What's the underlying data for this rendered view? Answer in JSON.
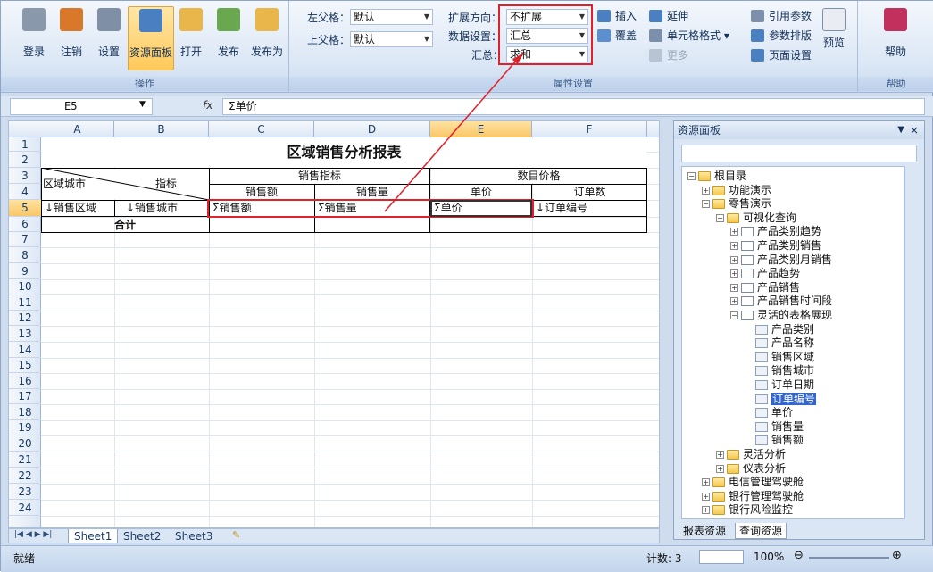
{
  "ribbon": {
    "buttons": [
      {
        "label": "登录",
        "icon": "login-icon",
        "color": "#8a98ac"
      },
      {
        "label": "注销",
        "icon": "logout-icon",
        "color": "#d9772b"
      },
      {
        "label": "设置",
        "icon": "settings-icon",
        "color": "#7f8fa6"
      },
      {
        "label": "资源面板",
        "icon": "resource-panel-icon",
        "color": "#4a7fc1"
      },
      {
        "label": "打开",
        "icon": "open-folder-icon",
        "color": "#e8b64a"
      },
      {
        "label": "发布",
        "icon": "publish-icon",
        "color": "#6aa84f"
      },
      {
        "label": "发布为",
        "icon": "publish-as-icon",
        "color": "#e8b64a"
      }
    ],
    "group_operation": "操作",
    "group_properties": "属性设置",
    "group_help": "帮助",
    "left_parent_label": "左父格：",
    "left_parent_value": "默认",
    "top_parent_label": "上父格：",
    "top_parent_value": "默认",
    "expand_dir_label": "扩展方向：",
    "expand_dir_value": "不扩展",
    "data_setting_label": "数据设置：",
    "data_setting_value": "汇总",
    "summary_label": "汇总：",
    "summary_value": "求和",
    "insert": "插入",
    "cover": "覆盖",
    "extend": "延伸",
    "cell_format": "单元格格式",
    "more": "更多",
    "ref_params": "引用参数",
    "param_layout": "参数排版",
    "page_setup": "页面设置",
    "preview": "预览",
    "help": "帮助"
  },
  "formula_bar": {
    "name_box": "E5",
    "fx": "fx",
    "formula": "Σ单价"
  },
  "sheet": {
    "columns": [
      "A",
      "B",
      "C",
      "D",
      "E",
      "F"
    ],
    "rows": [
      "1",
      "2",
      "3",
      "4",
      "5",
      "6",
      "7",
      "8",
      "9",
      "10",
      "11",
      "12",
      "13",
      "14",
      "15",
      "16",
      "17",
      "18",
      "19",
      "20",
      "21",
      "22",
      "23",
      "24"
    ],
    "title": "区域销售分析报表",
    "h_region_city": "区域城市",
    "h_indicator": "指标",
    "h_sales_metric": "销售指标",
    "h_price": "数目价格",
    "h_amount": "销售额",
    "h_qty": "销售量",
    "h_unit_price": "单价",
    "h_order_count": "订单数",
    "r5_a": "↓销售区域",
    "r5_b": "↓销售城市",
    "r5_c": "Σ销售额",
    "r5_d": "Σ销售量",
    "r5_e": "Σ单价",
    "r5_f": "↓订单编号",
    "total": "合计",
    "tabs": [
      "Sheet1",
      "Sheet2",
      "Sheet3"
    ]
  },
  "status": {
    "ready": "就绪",
    "count": "计数: 3",
    "zoom": "100%"
  },
  "panel": {
    "title": "资源面板",
    "tree": [
      {
        "label": "根目录",
        "level": 0,
        "type": "folder",
        "exp": "−"
      },
      {
        "label": "功能演示",
        "level": 1,
        "type": "folder",
        "exp": "+"
      },
      {
        "label": "零售演示",
        "level": 1,
        "type": "folder",
        "exp": "−"
      },
      {
        "label": "可视化查询",
        "level": 2,
        "type": "folder",
        "exp": "−"
      },
      {
        "label": "产品类别趋势",
        "level": 3,
        "type": "check",
        "exp": "+"
      },
      {
        "label": "产品类别销售",
        "level": 3,
        "type": "check",
        "exp": "+"
      },
      {
        "label": "产品类别月销售",
        "level": 3,
        "type": "check",
        "exp": "+"
      },
      {
        "label": "产品趋势",
        "level": 3,
        "type": "check",
        "exp": "+"
      },
      {
        "label": "产品销售",
        "level": 3,
        "type": "check",
        "exp": "+"
      },
      {
        "label": "产品销售时间段",
        "level": 3,
        "type": "check",
        "exp": "+"
      },
      {
        "label": "灵活的表格展现",
        "level": 3,
        "type": "check",
        "exp": "−"
      },
      {
        "label": "产品类别",
        "level": 4,
        "type": "doc",
        "exp": ""
      },
      {
        "label": "产品名称",
        "level": 4,
        "type": "doc",
        "exp": ""
      },
      {
        "label": "销售区域",
        "level": 4,
        "type": "doc",
        "exp": ""
      },
      {
        "label": "销售城市",
        "level": 4,
        "type": "doc",
        "exp": ""
      },
      {
        "label": "订单日期",
        "level": 4,
        "type": "doc",
        "exp": ""
      },
      {
        "label": "订单编号",
        "level": 4,
        "type": "doc",
        "exp": "",
        "selected": true
      },
      {
        "label": "单价",
        "level": 4,
        "type": "doc",
        "exp": ""
      },
      {
        "label": "销售量",
        "level": 4,
        "type": "doc",
        "exp": ""
      },
      {
        "label": "销售额",
        "level": 4,
        "type": "doc",
        "exp": ""
      },
      {
        "label": "灵活分析",
        "level": 2,
        "type": "folder",
        "exp": "+"
      },
      {
        "label": "仪表分析",
        "level": 2,
        "type": "folder",
        "exp": "+"
      },
      {
        "label": "电信管理驾驶舱",
        "level": 1,
        "type": "folder",
        "exp": "+"
      },
      {
        "label": "银行管理驾驶舱",
        "level": 1,
        "type": "folder",
        "exp": "+"
      },
      {
        "label": "银行风险监控",
        "level": 1,
        "type": "folder",
        "exp": "+"
      }
    ],
    "tab_report": "报表资源",
    "tab_query": "查询资源"
  },
  "colors": {
    "highlight": "#e0202a",
    "accent": "#4a7fc1"
  }
}
